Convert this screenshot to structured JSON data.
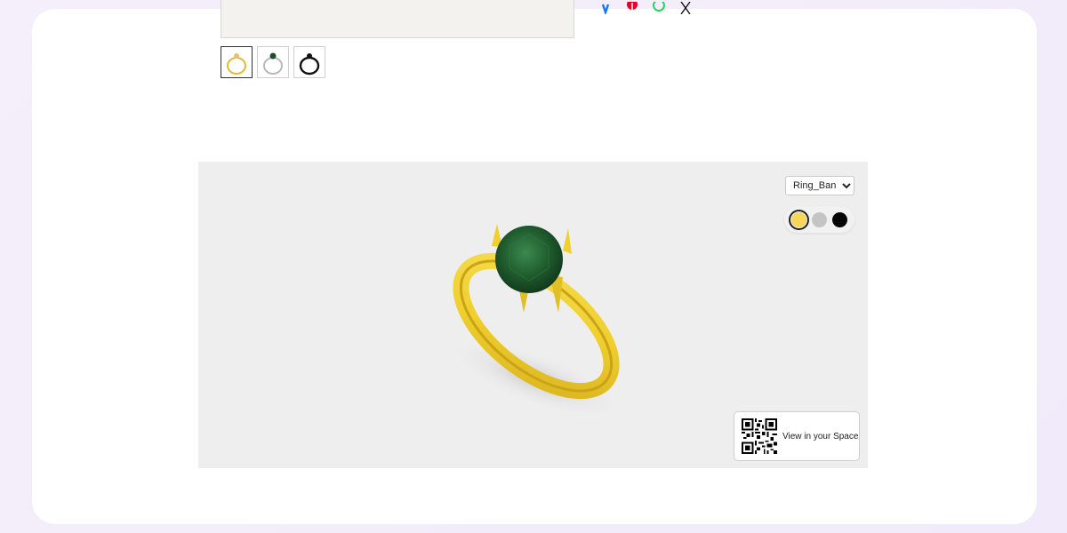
{
  "gallery": {
    "thumbnails": [
      {
        "variant": "gold",
        "color": "#e2b93b",
        "active": true
      },
      {
        "variant": "silver",
        "color": "#b8b8b8",
        "active": false
      },
      {
        "variant": "black",
        "color": "#111111",
        "active": false
      }
    ]
  },
  "share": {
    "icons": [
      "facebook-icon",
      "pinterest-icon",
      "whatsapp-icon",
      "x-icon"
    ],
    "colors": {
      "facebook": "#1877f2",
      "pinterest": "#e60023",
      "whatsapp": "#25d366",
      "x": "#111111"
    }
  },
  "viewer": {
    "variant_select": {
      "value": "Ring_Band",
      "options": [
        "Ring_Band"
      ]
    },
    "swatches": [
      {
        "name": "gold",
        "color": "#f6d75a",
        "selected": true
      },
      {
        "name": "silver",
        "color": "#c4c4c4",
        "selected": false
      },
      {
        "name": "black",
        "color": "#050505",
        "selected": false
      }
    ],
    "ar_button": {
      "label": "View in your Space"
    },
    "model": {
      "band_color": "#f0cf2e",
      "gem_color": "#1f5a2c"
    }
  }
}
